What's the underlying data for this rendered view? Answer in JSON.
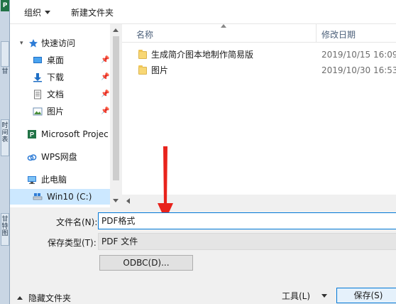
{
  "toolbar": {
    "organize_label": "组织",
    "new_folder_label": "新建文件夹"
  },
  "background_app": {
    "badge": "P",
    "tab_text_1": "甘",
    "tab_text_2": "时间表",
    "tab_text_3": "甘特图"
  },
  "nav": {
    "quick_access": {
      "label": "快速访问",
      "icon": "star-icon"
    },
    "items": [
      {
        "label": "桌面",
        "icon": "desktop-icon",
        "pinned": true
      },
      {
        "label": "下载",
        "icon": "download-icon",
        "pinned": true
      },
      {
        "label": "文档",
        "icon": "document-icon",
        "pinned": true
      },
      {
        "label": "图片",
        "icon": "pictures-icon",
        "pinned": true
      }
    ],
    "project": {
      "label": "Microsoft Projec",
      "icon": "project-icon"
    },
    "wps": {
      "label": "WPS网盘",
      "icon": "cloud-icon"
    },
    "this_pc": {
      "label": "此电脑",
      "icon": "computer-icon"
    },
    "drive": {
      "label": "Win10 (C:)",
      "icon": "drive-icon"
    }
  },
  "files": {
    "columns": {
      "name": "名称",
      "modified": "修改日期"
    },
    "rows": [
      {
        "name": "生成简介图本地制作简易版",
        "modified": "2019/10/15 16:09"
      },
      {
        "name": "图片",
        "modified": "2019/10/30 16:53"
      }
    ]
  },
  "form": {
    "filename_label": "文件名(N):",
    "filename_value": "PDF格式",
    "filetype_label": "保存类型(T):",
    "filetype_value": "PDF 文件",
    "odbc_label": "ODBC(D)..."
  },
  "bottom": {
    "hide_folders_label": "隐藏文件夹",
    "tools_label": "工具(L)",
    "save_label": "保存(S)"
  },
  "colors": {
    "accent": "#0078d7",
    "selection": "#cce8ff",
    "annotation": "#e8231c",
    "folder": "#f8d775"
  }
}
